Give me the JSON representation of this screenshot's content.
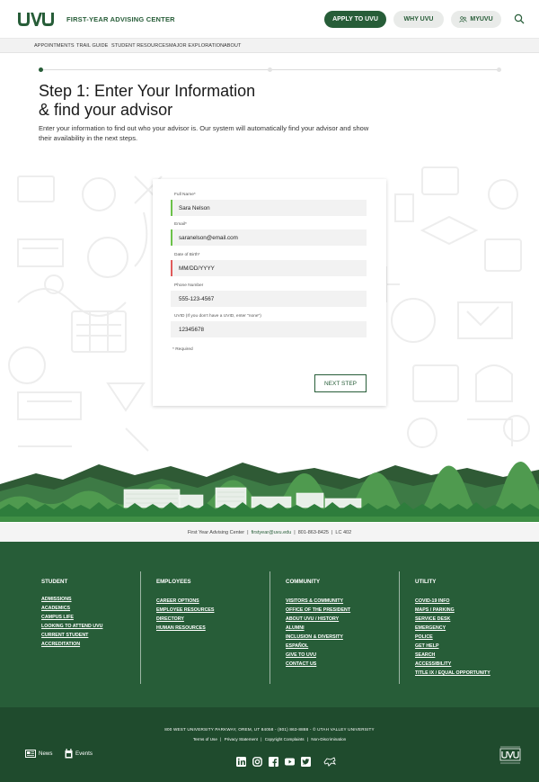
{
  "header": {
    "logo_text": "UVU",
    "site_title": "FIRST-YEAR ADVISING CENTER",
    "apply_label": "APPLY TO UVU",
    "why_label": "WHY UVU",
    "myuvu_label": "MYUVU"
  },
  "subnav": {
    "items": [
      "APPOINTMENTS",
      "TRAIL GUIDE",
      "STUDENT RESOURCES",
      "MAJOR EXPLORATION",
      "ABOUT"
    ]
  },
  "progress": {
    "current_step": 1,
    "total_steps": 3
  },
  "main": {
    "title_line1": "Step 1: Enter Your Information",
    "title_line2": "& find your advisor",
    "description": "Enter your information to find out who your advisor is. Our system will automatically find your advisor and show their availability in the next steps."
  },
  "form": {
    "full_name_label": "Full Name*",
    "full_name_value": "Sara Nelson",
    "email_label": "Email*",
    "email_value": "saranelson@email.com",
    "dob_label": "Date of Birth*",
    "dob_placeholder": "MM/DD/YYYY",
    "phone_label": "Phone Number",
    "phone_value": "555-123-4567",
    "uvid_label": "UVID (If you don't have a UVID, enter \"none\")",
    "uvid_value": "12345678",
    "required_note": "* Required",
    "next_label": "NEXT STEP"
  },
  "contact": {
    "center": "First Year Advising Center",
    "email": "firstyear@uvu.edu",
    "phone": "801-863-8425",
    "room": "LC 402",
    "sep": "|"
  },
  "footer": {
    "student": {
      "heading": "STUDENT",
      "links": [
        "ADMISSIONS",
        "ACADEMICS",
        "CAMPUS LIFE",
        "LOOKING TO ATTEND UVU",
        "CURRENT STUDENT",
        "ACCREDITATION"
      ]
    },
    "employees": {
      "heading": "EMPLOYEES",
      "links": [
        "CAREER OPTIONS",
        "EMPLOYEE RESOURCES",
        "DIRECTORY",
        "HUMAN RESOURCES"
      ]
    },
    "community": {
      "heading": "COMMUNITY",
      "links": [
        "VISITORS & COMMUNITY",
        "OFFICE OF THE PRESIDENT",
        "ABOUT UVU / HISTORY",
        "ALUMNI",
        "INCLUSION & DIVERSITY",
        "ESPAÑOL",
        "GIVE TO UVU",
        "CONTACT US"
      ]
    },
    "utility": {
      "heading": "UTILITY",
      "links": [
        "COVID-19 INFO",
        "MAPS / PARKING",
        "SERVICE DESK",
        "EMERGENCY",
        "POLICE",
        "GET HELP",
        "SEARCH",
        "ACCESSIBILITY",
        "TITLE IX / EQUAL OPPORTUNITY"
      ]
    }
  },
  "bottom": {
    "address": "800 WEST UNIVERSITY PARKWAY, OREM, UT 84058 - (801) 863-8888 - © UTAH VALLEY UNIVERSITY",
    "links": [
      "Terms of Use",
      "Privacy Statement",
      "Copyright Complaints",
      "Non-Discrimination"
    ],
    "sep": "|",
    "news_label": "News",
    "events_label": "Events"
  },
  "colors": {
    "brand": "#275d38",
    "ok": "#6cc24a",
    "error": "#e05a5a"
  }
}
